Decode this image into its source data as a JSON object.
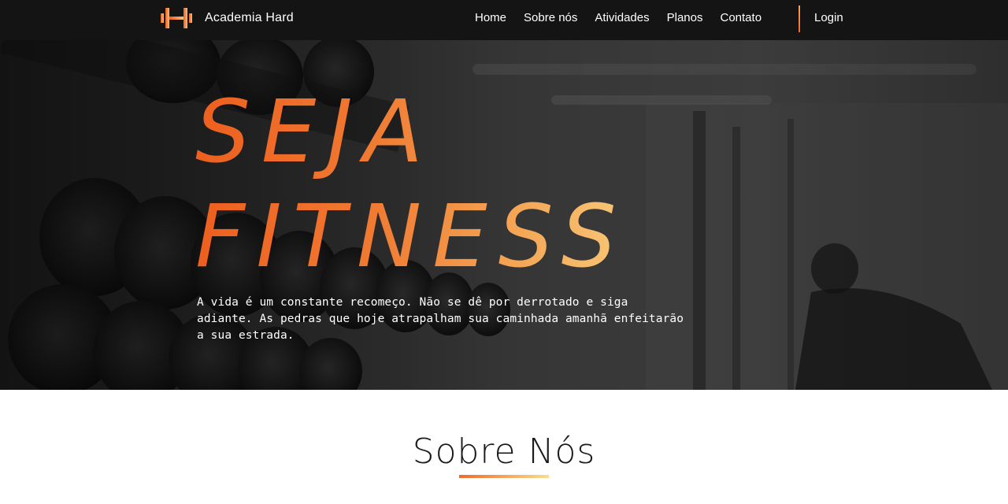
{
  "header": {
    "brand": "Academia Hard",
    "logo_icon": "dumbbell-h-icon",
    "nav": [
      "Home",
      "Sobre nós",
      "Atividades",
      "Planos",
      "Contato"
    ],
    "login": "Login"
  },
  "hero": {
    "title_line1": "SEJA",
    "title_line2": "FITNESS",
    "text": "A vida é um constante recomeço. Não se dê por derrotado e siga adiante. As pedras que hoje atrapalham sua caminhada amanhã enfeitarão a sua estrada."
  },
  "sobre": {
    "title": "Sobre Nós"
  },
  "colors": {
    "accent_start": "#ee5f1f",
    "accent_end": "#f9dd8e",
    "header_bg": "#141414"
  }
}
